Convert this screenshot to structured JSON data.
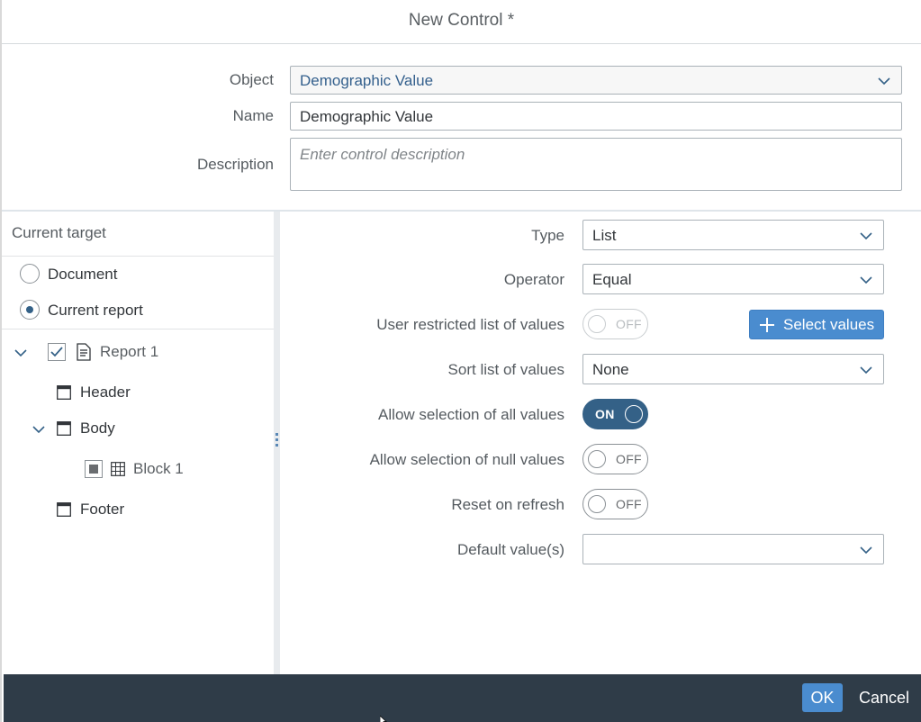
{
  "dialog": {
    "title": "New Control *"
  },
  "form": {
    "object_label": "Object",
    "object_value": "Demographic Value",
    "name_label": "Name",
    "name_value": "Demographic Value",
    "description_label": "Description",
    "description_placeholder": "Enter control description"
  },
  "target": {
    "header": "Current target",
    "options": [
      {
        "label": "Document",
        "selected": false
      },
      {
        "label": "Current report",
        "selected": true
      }
    ],
    "tree": {
      "report": "Report 1",
      "header": "Header",
      "body": "Body",
      "block": "Block 1",
      "footer": "Footer"
    }
  },
  "props": {
    "type_label": "Type",
    "type_value": "List",
    "operator_label": "Operator",
    "operator_value": "Equal",
    "restricted_label": "User restricted list of values",
    "restricted_state": "OFF",
    "select_values_label": "Select values",
    "sort_label": "Sort list of values",
    "sort_value": "None",
    "allow_all_label": "Allow selection of all values",
    "allow_all_state": "ON",
    "allow_null_label": "Allow selection of null values",
    "allow_null_state": "OFF",
    "reset_label": "Reset on refresh",
    "reset_state": "OFF",
    "default_label": "Default value(s)",
    "default_value": ""
  },
  "footer": {
    "ok_label": "OK",
    "cancel_label": "Cancel"
  },
  "colors": {
    "accent": "#346187",
    "button": "#4a8ccf",
    "footer": "#2f3c48"
  }
}
